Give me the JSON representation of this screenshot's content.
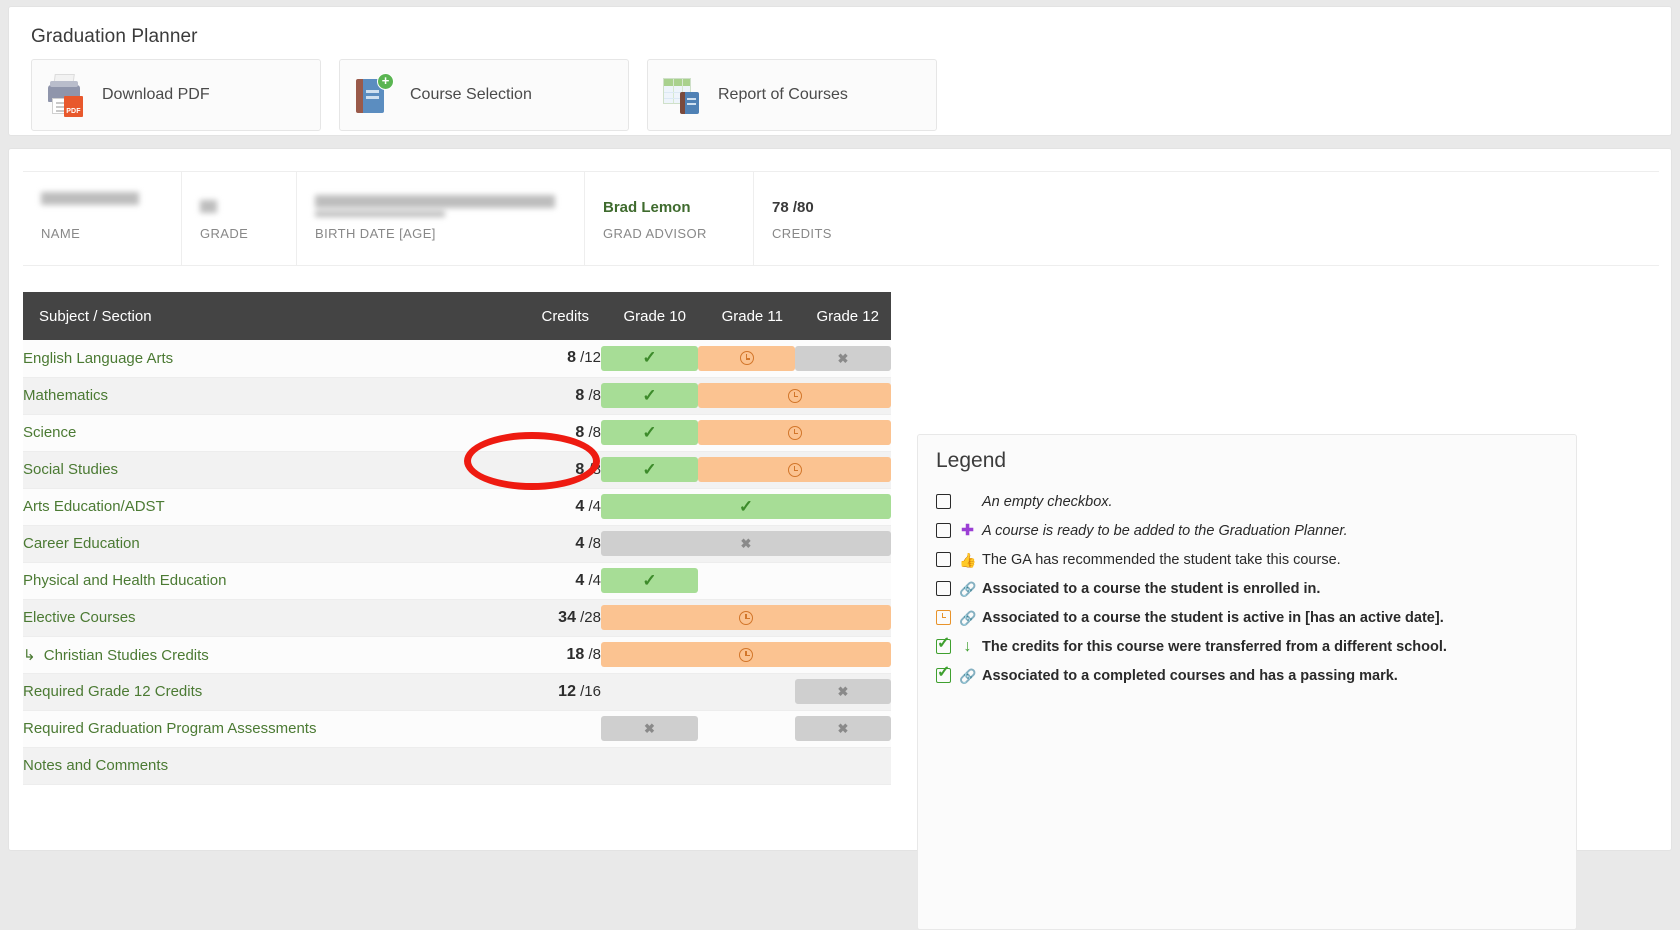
{
  "header": {
    "title": "Graduation Planner",
    "actions": [
      {
        "label": "Download PDF",
        "icon": "printer-pdf-icon"
      },
      {
        "label": "Course Selection",
        "icon": "book-plus-icon"
      },
      {
        "label": "Report of Courses",
        "icon": "report-grid-book-icon"
      }
    ]
  },
  "student": {
    "fields": [
      {
        "label": "NAME",
        "value": "",
        "redacted": true
      },
      {
        "label": "GRADE",
        "value": "",
        "redacted": true
      },
      {
        "label": "BIRTH DATE [AGE]",
        "value": "",
        "redacted": true
      },
      {
        "label": "GRAD ADVISOR",
        "value": "Brad Lemon",
        "redacted": false
      },
      {
        "label": "CREDITS",
        "value": "78 /80",
        "redacted": false
      }
    ]
  },
  "table": {
    "columns": [
      "Subject / Section",
      "Credits",
      "Grade 10",
      "Grade 11",
      "Grade 12"
    ],
    "rows": [
      {
        "subject": "English Language Arts",
        "indent": false,
        "earned": "8",
        "required": "/12",
        "g10": "check",
        "g11": "clock",
        "g12": "x",
        "span": "none"
      },
      {
        "subject": "Mathematics",
        "indent": false,
        "earned": "8",
        "required": "/8",
        "g10": "check",
        "g11": "clock",
        "g12": "",
        "span": "g11-g12"
      },
      {
        "subject": "Science",
        "indent": false,
        "earned": "8",
        "required": "/8",
        "g10": "check",
        "g11": "clock",
        "g12": "",
        "span": "g11-g12"
      },
      {
        "subject": "Social Studies",
        "indent": false,
        "earned": "8",
        "required": "/8",
        "g10": "check",
        "g11": "clock",
        "g12": "",
        "span": "g11-g12"
      },
      {
        "subject": "Arts Education/ADST",
        "indent": false,
        "earned": "4",
        "required": "/4",
        "g10": "check",
        "g11": "",
        "g12": "",
        "span": "g10-g12"
      },
      {
        "subject": "Career Education",
        "indent": false,
        "earned": "4",
        "required": "/8",
        "g10": "x",
        "g11": "",
        "g12": "",
        "span": "g10-g12"
      },
      {
        "subject": "Physical and Health Education",
        "indent": false,
        "earned": "4",
        "required": "/4",
        "g10": "check",
        "g11": "",
        "g12": "",
        "span": "none"
      },
      {
        "subject": "Elective Courses",
        "indent": false,
        "earned": "34",
        "required": "/28",
        "g10": "clock",
        "g11": "",
        "g12": "",
        "span": "g10-g12"
      },
      {
        "subject": "Christian Studies Credits",
        "indent": true,
        "earned": "18",
        "required": "/8",
        "g10": "clock",
        "g11": "",
        "g12": "",
        "span": "g10-g12"
      },
      {
        "subject": "Required Grade 12 Credits",
        "indent": false,
        "earned": "12",
        "required": "/16",
        "g10": "",
        "g11": "",
        "g12": "x",
        "span": "none"
      },
      {
        "subject": "Required Graduation Program Assessments",
        "indent": false,
        "earned": "",
        "required": "",
        "g10": "x",
        "g11": "",
        "g12": "x",
        "span": "none"
      },
      {
        "subject": "Notes and Comments",
        "indent": false,
        "earned": "",
        "required": "",
        "g10": "",
        "g11": "",
        "g12": "",
        "span": "none"
      }
    ]
  },
  "legend": {
    "title": "Legend",
    "items": [
      {
        "checkbox": "empty",
        "marker": "",
        "text": "An empty checkbox.",
        "style": "italic"
      },
      {
        "checkbox": "empty",
        "marker": "plus",
        "text": "A course is ready to be added to the Graduation Planner.",
        "style": "italic"
      },
      {
        "checkbox": "empty",
        "marker": "thumb",
        "text": "The GA has recommended the student take this course.",
        "style": "normal"
      },
      {
        "checkbox": "empty",
        "marker": "link",
        "text": "Associated to a course the student is enrolled in.",
        "style": "bold"
      },
      {
        "checkbox": "orange",
        "marker": "link",
        "text": "Associated to a course the student is active in [has an active date].",
        "style": "bold"
      },
      {
        "checkbox": "checked",
        "marker": "down",
        "text": "The credits for this course were transferred from a different school.",
        "style": "bold"
      },
      {
        "checkbox": "checked",
        "marker": "link",
        "text": "Associated to a completed courses and has a passing mark.",
        "style": "bold"
      }
    ]
  },
  "annotation": {
    "shape": "red-ellipse",
    "target": "Credits",
    "color": "#ee1b11"
  }
}
